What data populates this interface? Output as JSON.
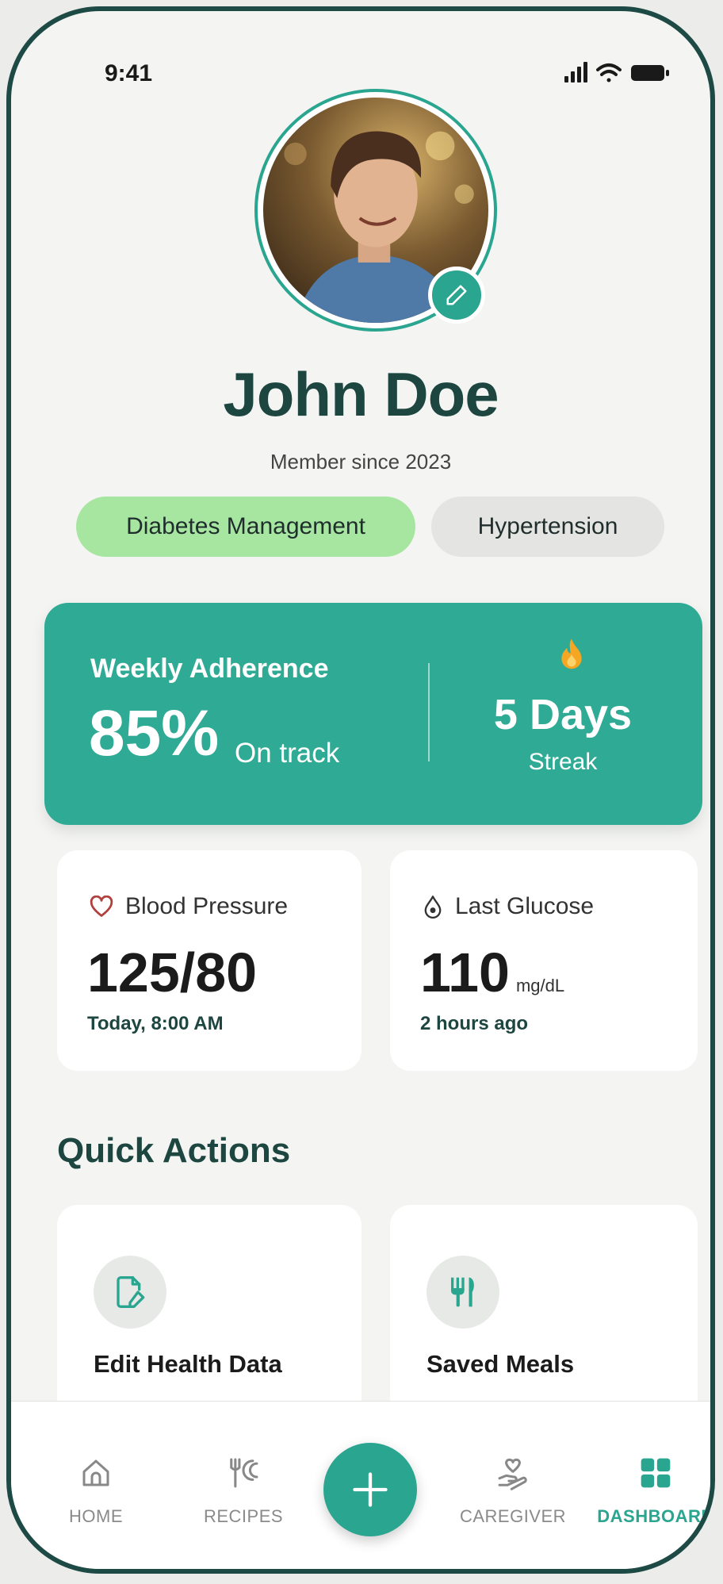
{
  "status_bar": {
    "time": "9:41"
  },
  "profile": {
    "name": "John Doe",
    "member_since": "Member since 2023",
    "tags": [
      "Diabetes Management",
      "Hypertension"
    ]
  },
  "adherence": {
    "label": "Weekly Adherence",
    "value": "85%",
    "status": "On track",
    "streak_value": "5 Days",
    "streak_label": "Streak"
  },
  "stats": {
    "blood_pressure": {
      "label": "Blood Pressure",
      "value": "125/80",
      "time": "Today, 8:00 AM"
    },
    "glucose": {
      "label": "Last Glucose",
      "value": "110",
      "unit": "mg/dL",
      "time": "2 hours ago"
    }
  },
  "quick_actions": {
    "title": "Quick Actions",
    "items": [
      {
        "label": "Edit Health Data",
        "icon": "edit-document-icon"
      },
      {
        "label": "Saved Meals",
        "icon": "utensils-icon"
      }
    ]
  },
  "bottom_nav": {
    "items": [
      {
        "label": "HOME",
        "icon": "home-icon"
      },
      {
        "label": "RECIPES",
        "icon": "recipes-icon"
      },
      {
        "label": "CAREGIVER",
        "icon": "caregiver-icon"
      },
      {
        "label": "DASHBOARD",
        "icon": "dashboard-icon",
        "active": true
      }
    ],
    "fab_icon": "plus-icon"
  },
  "colors": {
    "brand": "#2aa58f",
    "heading": "#1d4640",
    "tag_active": "#a6e6a0",
    "tag_inactive": "#e4e5e3",
    "streak_flame": "#f5a623",
    "heart": "#b0413e"
  }
}
